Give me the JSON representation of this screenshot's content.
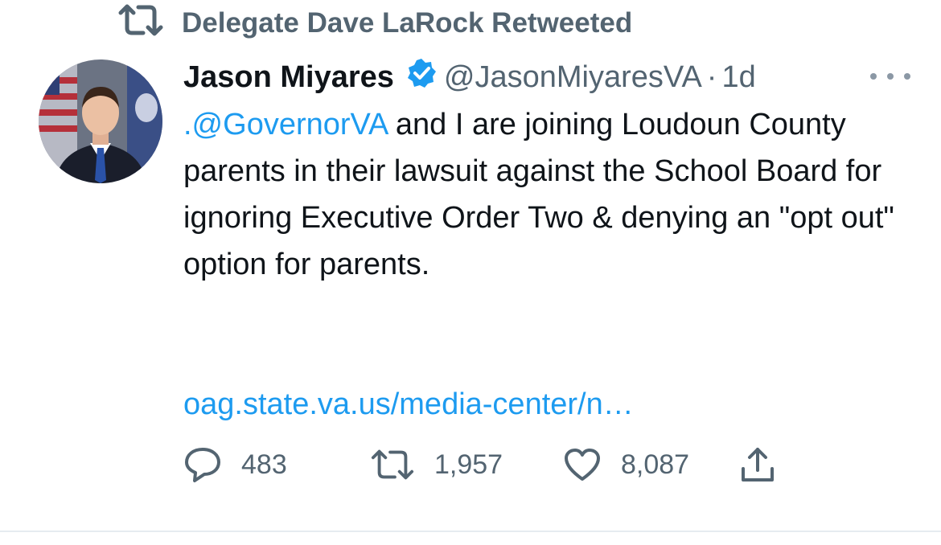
{
  "retweet_context": {
    "label": "Delegate Dave LaRock Retweeted",
    "icon": "retweet-icon"
  },
  "tweet": {
    "author": {
      "name": "Jason Miyares",
      "handle": "@JasonMiyaresVA",
      "verified": true,
      "verified_icon": "verified-badge-icon"
    },
    "separator": "·",
    "timestamp": "1d",
    "text": {
      "mention": ".@GovernorVA",
      "body": " and I are joining Loudoun County parents in their lawsuit against the School Board for ignoring Executive Order Two & denying an \"opt out\" option for parents."
    },
    "link": "oag.state.va.us/media-center/n…",
    "actions": {
      "reply_count": "483",
      "retweet_count": "1,957",
      "like_count": "8,087"
    }
  },
  "colors": {
    "accent": "#1d9bf0",
    "muted": "#536471",
    "text": "#0f1419"
  }
}
